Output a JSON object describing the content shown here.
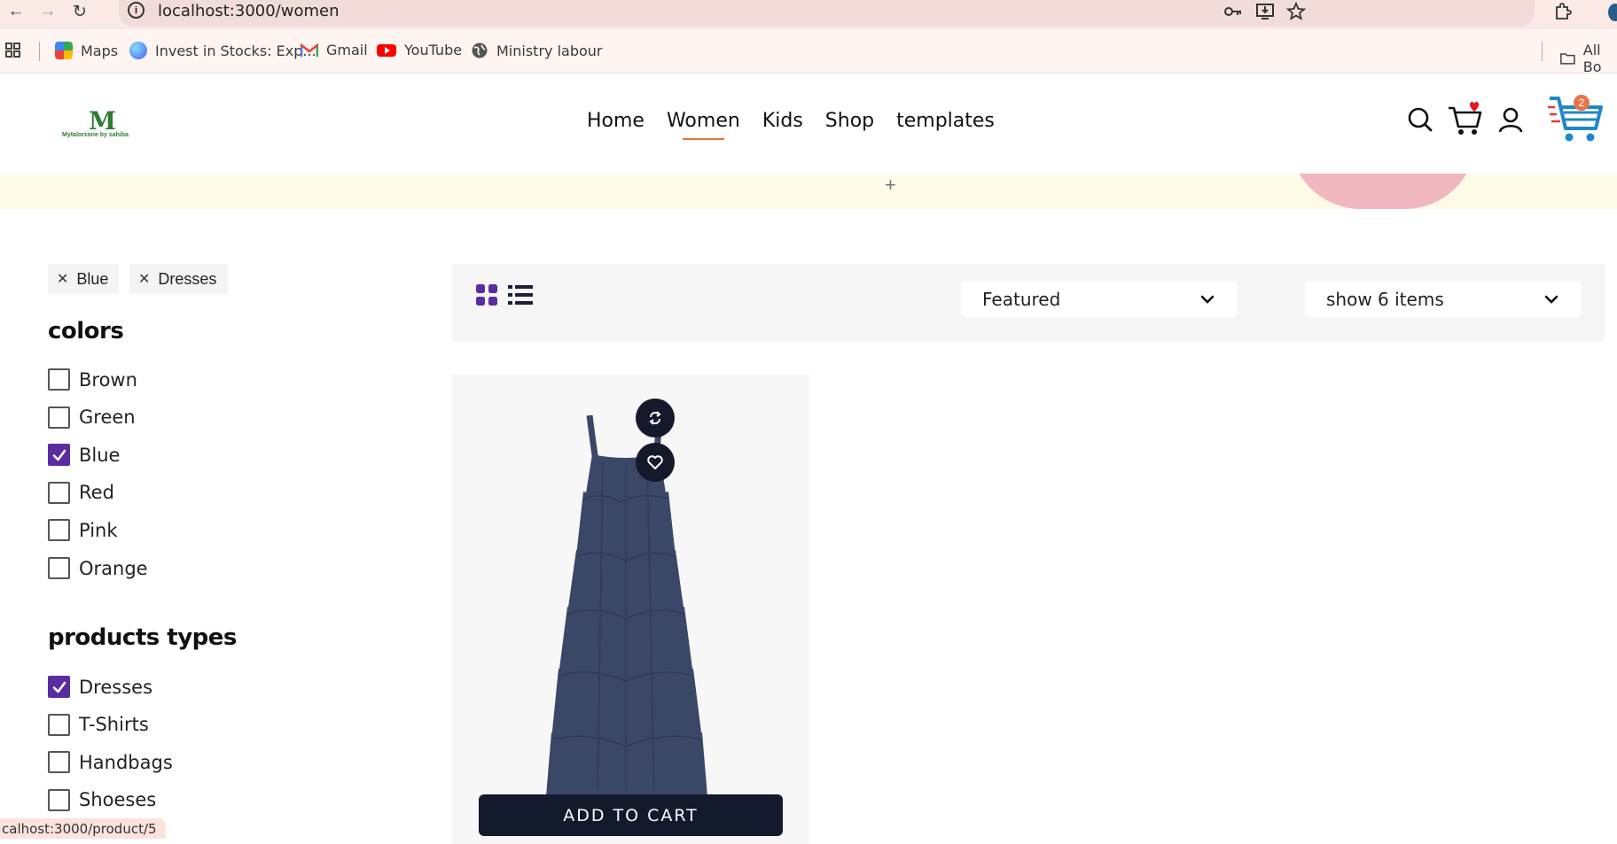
{
  "browser": {
    "url": "localhost:3000/women",
    "bookmarks": [
      "Maps",
      "Invest in Stocks: Exp...",
      "Gmail",
      "YouTube",
      "Ministry labour"
    ],
    "all_bookmarks_label": "All Bo",
    "status_url": "calhost:3000/product/5"
  },
  "site": {
    "logo_mark": "M",
    "logo_text": "Mytalorzone by sahiba",
    "nav": [
      "Home",
      "Women",
      "Kids",
      "Shop",
      "templates"
    ],
    "active_nav": "Women",
    "cart_count": "2",
    "brand_color": "#5b2ca0",
    "accent_color": "#e8743c"
  },
  "filters": {
    "active_chips": [
      "Blue",
      "Dresses"
    ],
    "colors_title": "colors",
    "colors": [
      {
        "label": "Brown",
        "checked": false
      },
      {
        "label": "Green",
        "checked": false
      },
      {
        "label": "Blue",
        "checked": true
      },
      {
        "label": "Red",
        "checked": false
      },
      {
        "label": "Pink",
        "checked": false
      },
      {
        "label": "Orange",
        "checked": false
      }
    ],
    "types_title": "products types",
    "types": [
      {
        "label": "Dresses",
        "checked": true
      },
      {
        "label": "T-Shirts",
        "checked": false
      },
      {
        "label": "Handbags",
        "checked": false
      },
      {
        "label": "Shoeses",
        "checked": false
      }
    ]
  },
  "toolbar": {
    "sort_value": "Featured",
    "show_value": "show 6 items"
  },
  "product": {
    "add_to_cart_label": "ADD TO CART",
    "dress_color": "#3b4767"
  }
}
